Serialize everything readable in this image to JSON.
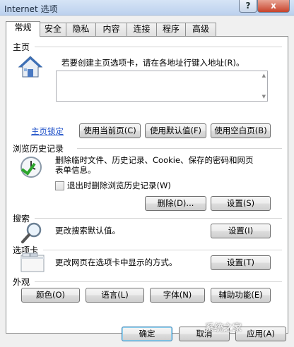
{
  "window": {
    "title": "Internet 选项",
    "help_label": "?",
    "close_label": "x"
  },
  "tabs": [
    {
      "label": "常规"
    },
    {
      "label": "安全"
    },
    {
      "label": "隐私"
    },
    {
      "label": "内容"
    },
    {
      "label": "连接"
    },
    {
      "label": "程序"
    },
    {
      "label": "高级"
    }
  ],
  "home": {
    "title": "主页",
    "description": "若要创建主页选项卡，请在各地址行键入地址(R)。",
    "url_value": "",
    "lock_link": "主页锁定",
    "use_current": "使用当前页(C)",
    "use_default": "使用默认值(F)",
    "use_blank": "使用空白页(B)"
  },
  "history": {
    "title": "浏览历史记录",
    "description_line1": "删除临时文件、历史记录、Cookie、保存的密码和网页",
    "description_line2": "表单信息。",
    "checkbox_label": "退出时删除浏览历史记录(W)",
    "checkbox_checked": false,
    "delete_button": "删除(D)...",
    "settings_button": "设置(S)"
  },
  "search": {
    "title": "搜索",
    "description": "更改搜索默认值。",
    "settings_button": "设置(I)"
  },
  "tabs_section": {
    "title": "选项卡",
    "description": "更改网页在选项卡中显示的方式。",
    "settings_button": "设置(T)"
  },
  "appearance": {
    "title": "外观",
    "colors": "颜色(O)",
    "languages": "语言(L)",
    "fonts": "字体(N)",
    "accessibility": "辅助功能(E)"
  },
  "footer": {
    "ok": "确定",
    "cancel": "取消",
    "apply": "应用(A)"
  },
  "watermark": "系统之家",
  "colors": {
    "link": "#1e50c8",
    "close_button": "#c7432b",
    "default_button_border": "#3c7fb1"
  }
}
